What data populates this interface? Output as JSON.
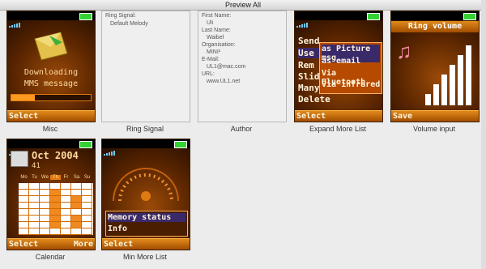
{
  "window": {
    "title": "Preview All"
  },
  "misc": {
    "caption": "Misc",
    "line1": "Downloading",
    "line2": "MMS message",
    "soft_left": "Select"
  },
  "ring": {
    "caption": "Ring Signal",
    "line1": "Ring Signal:",
    "line2": "Default Melody"
  },
  "author": {
    "caption": "Author",
    "lines": [
      "First Name:",
      "Uli",
      "Last Name:",
      "Waibel",
      "Organisation:",
      "MINI²",
      "E-Mail:",
      "UL1@mac.com",
      "URL:",
      "www.UL1.net"
    ]
  },
  "expand": {
    "caption": "Expand More List",
    "left_items": [
      "Send",
      "Use",
      "Rem",
      "Slid",
      "Many",
      "Delete"
    ],
    "popup_items": [
      "as Picture msg",
      "as email",
      "Via Bluetooth",
      "Via infrared"
    ],
    "soft_left": "Select"
  },
  "volume": {
    "caption": "Volume input",
    "title": "Ring volume",
    "level": 6,
    "max": 6,
    "soft_left": "Save"
  },
  "calendar": {
    "caption": "Calendar",
    "month": "Oct 2004",
    "week": "41",
    "days": [
      "Mo",
      "Tu",
      "We",
      "Th",
      "Fr",
      "Sa",
      "Su"
    ],
    "soft_left": "Select",
    "soft_right": "More"
  },
  "minmore": {
    "caption": "Min More List",
    "items": [
      "Memory status",
      "Info"
    ],
    "soft_left": "Select"
  },
  "colors": {
    "accent": "#e07a10",
    "dark": "#1c0a00",
    "highlight": "#3a2a6a"
  }
}
